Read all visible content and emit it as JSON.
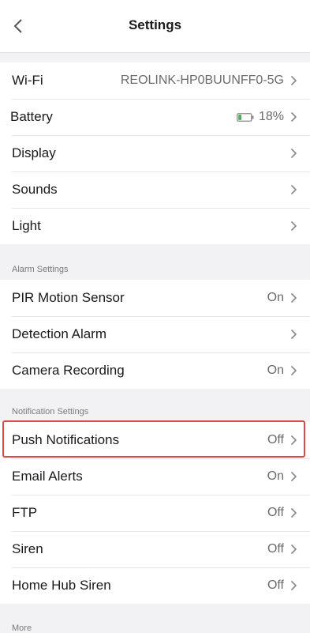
{
  "header": {
    "title": "Settings"
  },
  "device": [
    {
      "label": "Wi-Fi",
      "value": "REOLINK-HP0BUUNFF0-5G"
    },
    {
      "label": "Battery",
      "value": "18%",
      "battery_level": 0.18
    },
    {
      "label": "Display",
      "value": ""
    },
    {
      "label": "Sounds",
      "value": ""
    },
    {
      "label": "Light",
      "value": ""
    }
  ],
  "alarm": {
    "title": "Alarm Settings",
    "items": [
      {
        "label": "PIR Motion Sensor",
        "value": "On"
      },
      {
        "label": "Detection Alarm",
        "value": ""
      },
      {
        "label": "Camera Recording",
        "value": "On"
      }
    ]
  },
  "notification": {
    "title": "Notification Settings",
    "items": [
      {
        "label": "Push Notifications",
        "value": "Off"
      },
      {
        "label": "Email Alerts",
        "value": "On"
      },
      {
        "label": "FTP",
        "value": "Off"
      },
      {
        "label": "Siren",
        "value": "Off"
      },
      {
        "label": "Home Hub Siren",
        "value": "Off"
      }
    ]
  },
  "more": {
    "title": "More"
  },
  "colors": {
    "highlight": "#e04848",
    "battery": "#3db34a"
  }
}
